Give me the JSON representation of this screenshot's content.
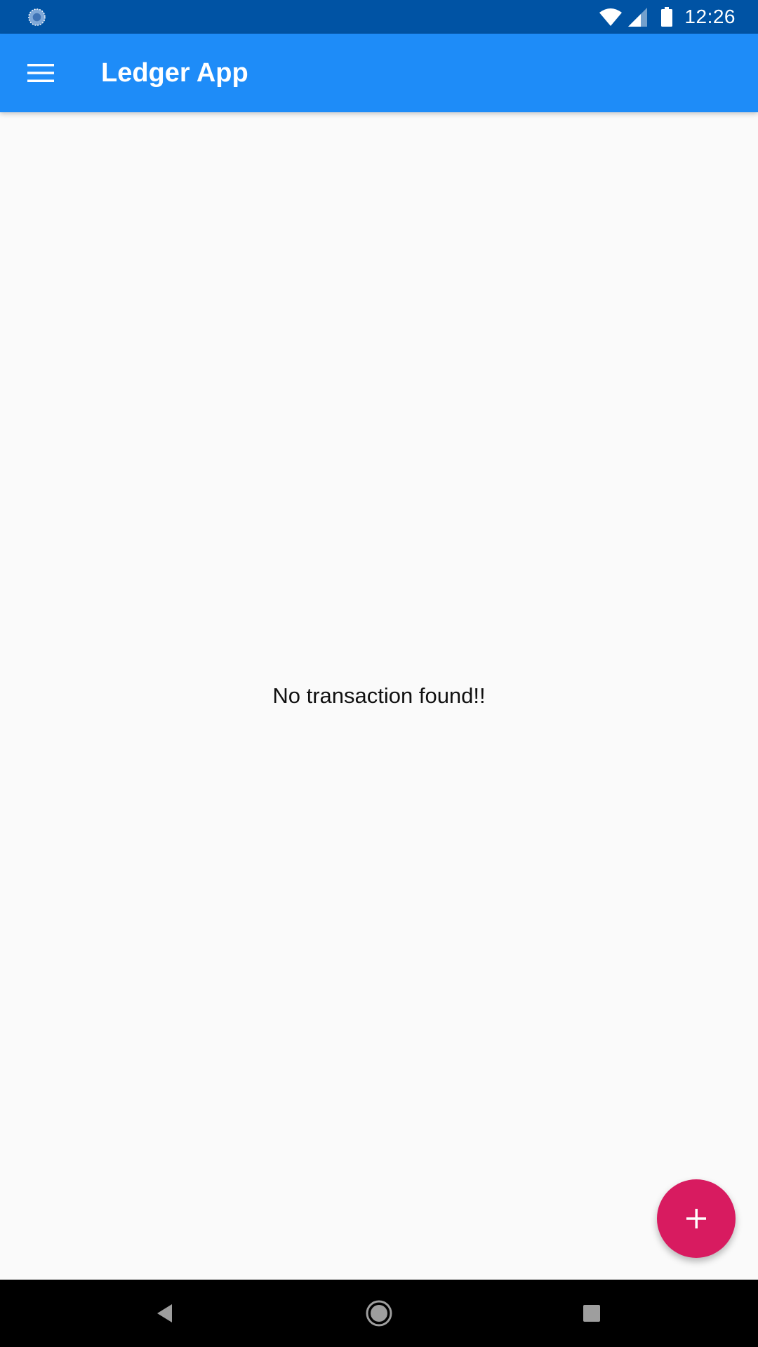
{
  "status_bar": {
    "time": "12:26",
    "left_icon": "sync-circle-icon",
    "icons": [
      "wifi-icon",
      "signal-icon",
      "battery-icon"
    ],
    "background": "#0053a4"
  },
  "app_bar": {
    "title": "Ledger App",
    "menu_icon": "hamburger-menu-icon",
    "background": "#1e8cf8"
  },
  "main": {
    "empty_message": "No transaction found!!"
  },
  "fab": {
    "icon": "plus-icon",
    "color": "#d81b60"
  },
  "nav_bar": {
    "buttons": [
      "back-icon",
      "home-icon",
      "recents-icon"
    ]
  }
}
